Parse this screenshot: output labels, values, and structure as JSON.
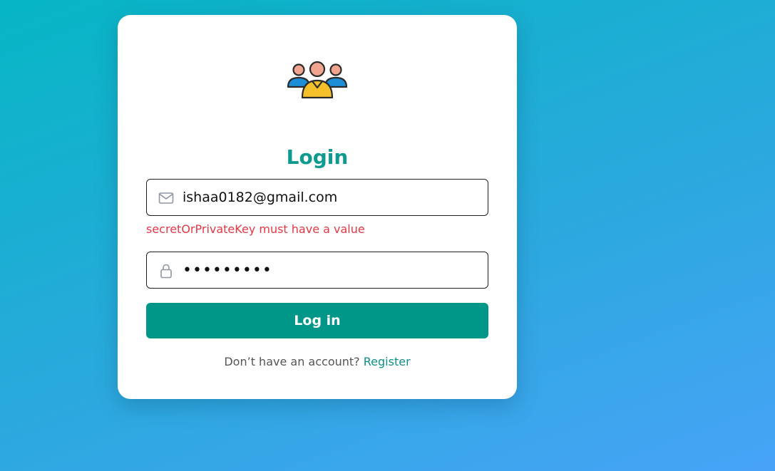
{
  "login": {
    "title": "Login",
    "email_value": "ishaa0182@gmail.com",
    "email_icon": "envelope-icon",
    "error_message": "secretOrPrivateKey must have a value",
    "password_value": "•••••••••",
    "password_icon": "lock-icon",
    "submit_label": "Log in",
    "footer_text": "Don’t have an account?",
    "register_link": "Register",
    "logo_icon": "users-group-icon"
  },
  "colors": {
    "accent": "#009688",
    "title": "#0e9a8e",
    "error": "#e53845",
    "background_start": "#06b6c4",
    "background_end": "#47a3f7"
  }
}
